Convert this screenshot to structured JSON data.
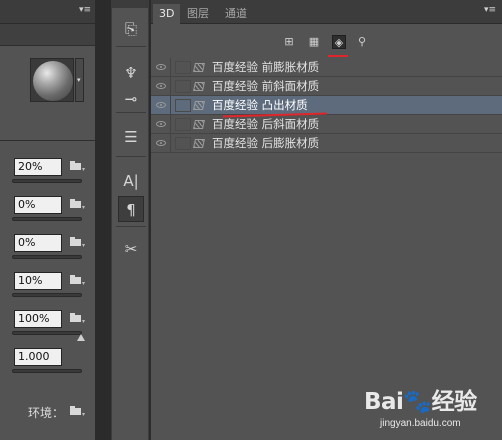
{
  "left_panel": {
    "menu_icon": "panel-menu-icon",
    "material_preview": "material-sphere-thumbnail",
    "rows": [
      {
        "value": "20%",
        "has_slider": true,
        "has_thumb": false
      },
      {
        "value": "0%",
        "has_slider": true,
        "has_thumb": false
      },
      {
        "value": "0%",
        "has_slider": true,
        "has_thumb": false
      },
      {
        "value": "10%",
        "has_slider": true,
        "has_thumb": false
      },
      {
        "value": "100%",
        "has_slider": true,
        "has_thumb": true
      },
      {
        "value": "1.000",
        "has_slider": true,
        "has_thumb": false,
        "no_folder": true
      }
    ],
    "environment_label": "环境："
  },
  "toolbar": {
    "buttons": [
      {
        "icon": "history-panel-icon",
        "glyph": "⎘"
      },
      {
        "icon": "brush-presets-icon",
        "glyph": "♆"
      },
      {
        "icon": "tool-presets-icon",
        "glyph": "⊸"
      },
      {
        "icon": "clone-source-icon",
        "glyph": "☰"
      },
      {
        "icon": "character-panel-icon",
        "glyph": "A|"
      },
      {
        "icon": "paragraph-panel-icon",
        "glyph": "¶",
        "active": true
      },
      {
        "icon": "tools-crossed-icon",
        "glyph": "✂"
      }
    ]
  },
  "panel3d": {
    "tabs": [
      {
        "label": "3D",
        "active": true
      },
      {
        "label": "图层",
        "active": false
      },
      {
        "label": "通道",
        "active": false
      }
    ],
    "filters": [
      {
        "icon": "whole-scene-filter-icon",
        "glyph": "⊞",
        "active": false
      },
      {
        "icon": "meshes-filter-icon",
        "glyph": "▦",
        "active": false
      },
      {
        "icon": "materials-filter-icon",
        "glyph": "◈",
        "active": true
      },
      {
        "icon": "lights-filter-icon",
        "glyph": "⚲",
        "active": false
      }
    ],
    "items": [
      {
        "label": "百度经验 前膨胀材质",
        "selected": false
      },
      {
        "label": "百度经验 前斜面材质",
        "selected": false
      },
      {
        "label": "百度经验 凸出材质",
        "selected": true
      },
      {
        "label": "百度经验 后斜面材质",
        "selected": false
      },
      {
        "label": "百度经验 后膨胀材质",
        "selected": false
      }
    ]
  },
  "watermark": {
    "logo": "Bai🐾经验",
    "url": "jingyan.baidu.com"
  },
  "colors": {
    "panel_bg": "#535353",
    "selected_row": "#5d6b7d",
    "annotation_red": "#e0262b"
  }
}
